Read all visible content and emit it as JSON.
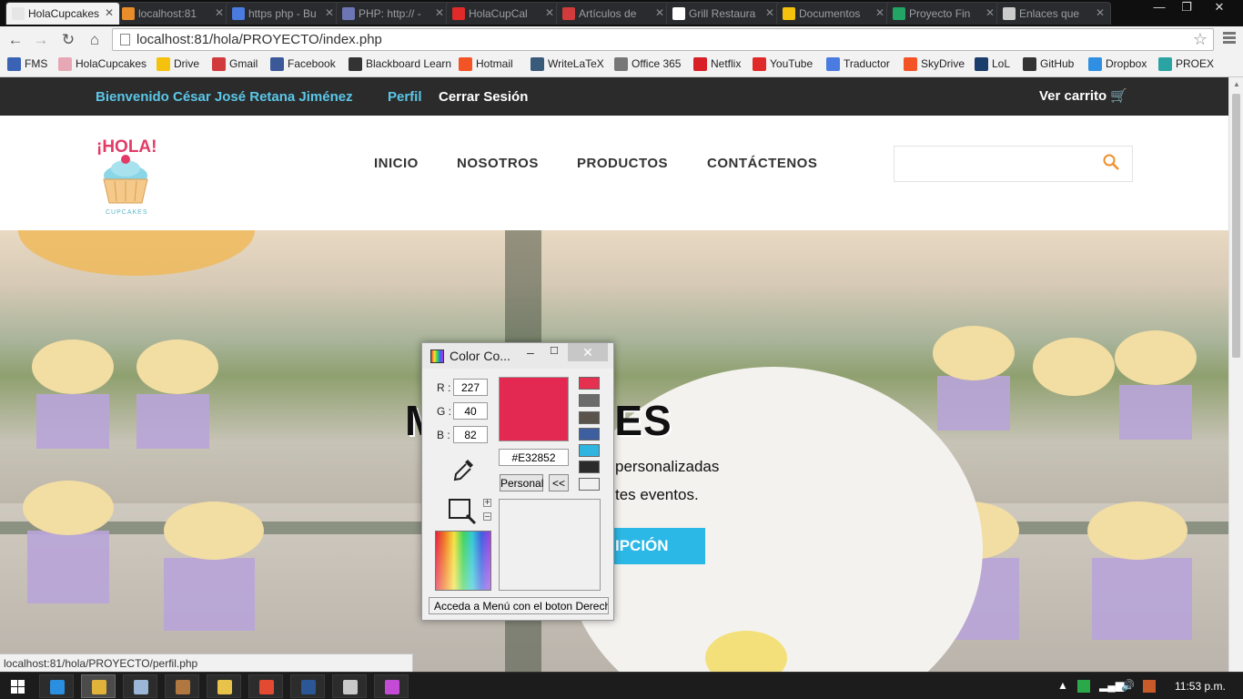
{
  "browser": {
    "tabs": [
      {
        "label": "HolaCupcakes",
        "active": true,
        "icon": "cupcake-icon",
        "color": "#e6e6e6"
      },
      {
        "label": "localhost:81",
        "active": false,
        "icon": "phpmyadmin-icon",
        "color": "#e98c2a"
      },
      {
        "label": "https php - Bu",
        "active": false,
        "icon": "google-icon",
        "color": "#4a7be0"
      },
      {
        "label": "PHP: http:// -",
        "active": false,
        "icon": "php-icon",
        "color": "#6d76b5"
      },
      {
        "label": "HolaCupCal",
        "active": false,
        "icon": "youtube-icon",
        "color": "#e02a2a"
      },
      {
        "label": "Artículos de",
        "active": false,
        "icon": "gmail-icon",
        "color": "#d13b3b"
      },
      {
        "label": "Grill Restaura",
        "active": false,
        "icon": "page-icon",
        "color": "#ffffff"
      },
      {
        "label": "Documentos",
        "active": false,
        "icon": "drive-icon",
        "color": "#f4c20d"
      },
      {
        "label": "Proyecto Fin",
        "active": false,
        "icon": "sheets-icon",
        "color": "#22a464"
      },
      {
        "label": "Enlaces que",
        "active": false,
        "icon": "link-icon",
        "color": "#cccccc"
      }
    ],
    "address": "localhost:81/hola/PROYECTO/index.php",
    "bookmarks": [
      {
        "label": "FMS",
        "icon": "fms-icon",
        "color": "#3a62b5"
      },
      {
        "label": "HolaCupcakes",
        "icon": "cupcake-icon",
        "color": "#e7a8b5"
      },
      {
        "label": "Drive",
        "icon": "drive-icon",
        "color": "#f4c20d"
      },
      {
        "label": "Gmail",
        "icon": "gmail-icon",
        "color": "#d13b3b"
      },
      {
        "label": "Facebook",
        "icon": "facebook-icon",
        "color": "#3b5998"
      },
      {
        "label": "Blackboard Learn",
        "icon": "blackboard-icon",
        "color": "#333333"
      },
      {
        "label": "Hotmail",
        "icon": "windows-icon",
        "color": "#f35325"
      },
      {
        "label": "WriteLaTeX",
        "icon": "writelatex-icon",
        "color": "#3a5a7a"
      },
      {
        "label": "Office 365",
        "icon": "office-icon",
        "color": "#777777"
      },
      {
        "label": "Netflix",
        "icon": "netflix-icon",
        "color": "#d81f26"
      },
      {
        "label": "YouTube",
        "icon": "youtube-icon",
        "color": "#e02a2a"
      },
      {
        "label": "Traductor",
        "icon": "translate-icon",
        "color": "#4a7be0"
      },
      {
        "label": "SkyDrive",
        "icon": "windows-icon",
        "color": "#f35325"
      },
      {
        "label": "LoL",
        "icon": "lol-icon",
        "color": "#1b3d6b"
      },
      {
        "label": "GitHub",
        "icon": "github-icon",
        "color": "#333333"
      },
      {
        "label": "Dropbox",
        "icon": "dropbox-icon",
        "color": "#2f8fe3"
      },
      {
        "label": "PROEX",
        "icon": "proex-icon",
        "color": "#2aa3a3"
      }
    ]
  },
  "site": {
    "welcome": "Bienvenido César José Retana Jiménez",
    "profile_link": "Perfil",
    "logout_link": "Cerrar Sesión",
    "cart_link": "Ver carrito",
    "logo_text_top": "¡HOLA!",
    "logo_text_bottom": "CUPCAKES",
    "nav": [
      "INICIO",
      "NOSOTROS",
      "PRODUCTOS",
      "CONTÁCTENOS"
    ],
    "search_value": "",
    "hero": {
      "title": "M         E DULCES",
      "line1": "personalizadas",
      "line2": "tes eventos.",
      "button": "IPCIÓN"
    },
    "status_url": "localhost:81/hola/PROYECTO/perfil.php",
    "accent": "#2cb8e6",
    "welcome_color": "#5bc7e8"
  },
  "color_picker": {
    "title": "Color Co...",
    "r_label": "R :",
    "g_label": "G :",
    "b_label": "B :",
    "r": "227",
    "g": "40",
    "b": "82",
    "hex": "#E32852",
    "current_color": "#e32852",
    "personal_button": "Personal",
    "back_button": "<<",
    "palette": [
      "#e6304f",
      "#6b6b6b",
      "#5a534b",
      "#3d5fa0",
      "#2fb5e0",
      "#2b2b2b",
      "#f0f0f0"
    ],
    "status": "Acceda a Menú con el boton Derecho"
  },
  "taskbar": {
    "clock": "11:53 p.m.",
    "apps": [
      {
        "name": "ie-icon",
        "color": "#2a8fe0"
      },
      {
        "name": "chrome-icon",
        "color": "#e2b33a"
      },
      {
        "name": "notepad-icon",
        "color": "#9bb6d6"
      },
      {
        "name": "media-icon",
        "color": "#b07840"
      },
      {
        "name": "explorer-icon",
        "color": "#e8c34a"
      },
      {
        "name": "git-icon",
        "color": "#e24b32"
      },
      {
        "name": "word-icon",
        "color": "#2b5797"
      },
      {
        "name": "paint-icon",
        "color": "#c9c9c9"
      },
      {
        "name": "color-picker-icon",
        "color": "#c34bd6"
      }
    ]
  }
}
